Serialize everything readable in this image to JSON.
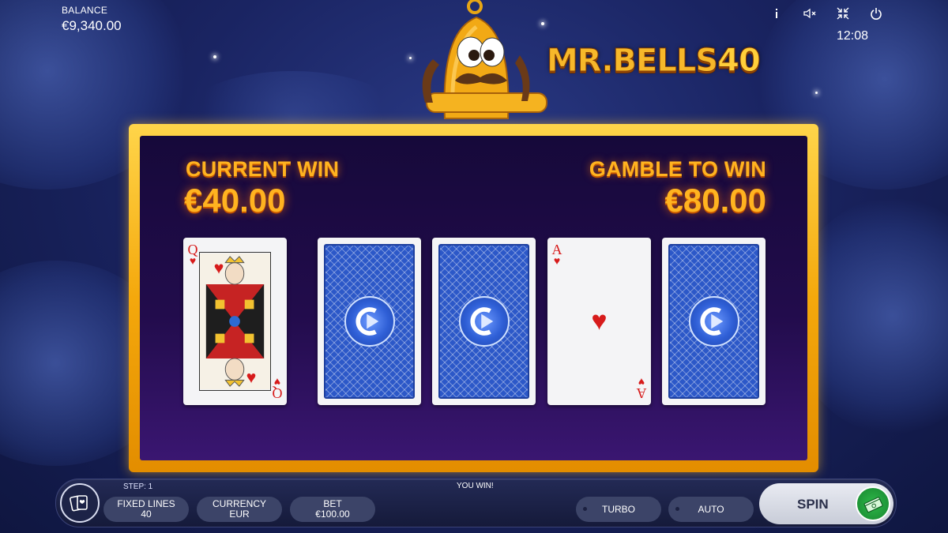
{
  "balance": {
    "label": "BALANCE",
    "value": "€9,340.00"
  },
  "clock": "12:08",
  "hud_icons": [
    "info-icon",
    "sound-muted-icon",
    "fullscreen-exit-icon",
    "power-icon"
  ],
  "logo": {
    "text": "MR.BELLS",
    "number": "40"
  },
  "gamble": {
    "current_win_label": "CURRENT WIN",
    "current_win_value": "€40.00",
    "gamble_to_win_label": "GAMBLE TO WIN",
    "gamble_to_win_value": "€80.00"
  },
  "cards": [
    {
      "state": "face-up",
      "rank": "Q",
      "suit": "♥",
      "role": "dealer"
    },
    {
      "state": "face-down"
    },
    {
      "state": "face-down"
    },
    {
      "state": "face-up",
      "rank": "A",
      "suit": "♥",
      "role": "picked"
    },
    {
      "state": "face-down"
    }
  ],
  "bottom": {
    "step": "STEP: 1",
    "message": "YOU WIN!",
    "fixed_lines_label": "FIXED LINES",
    "fixed_lines_value": "40",
    "currency_label": "CURRENCY",
    "currency_value": "EUR",
    "bet_label": "BET",
    "bet_value": "€100.00",
    "turbo_label": "TURBO",
    "auto_label": "AUTO",
    "spin_label": "SPIN"
  },
  "colors": {
    "gold_frame": "#f4a80c",
    "win_text": "#ffb320",
    "card_back": "#2c58c8",
    "spin_green": "#2eb94a"
  }
}
